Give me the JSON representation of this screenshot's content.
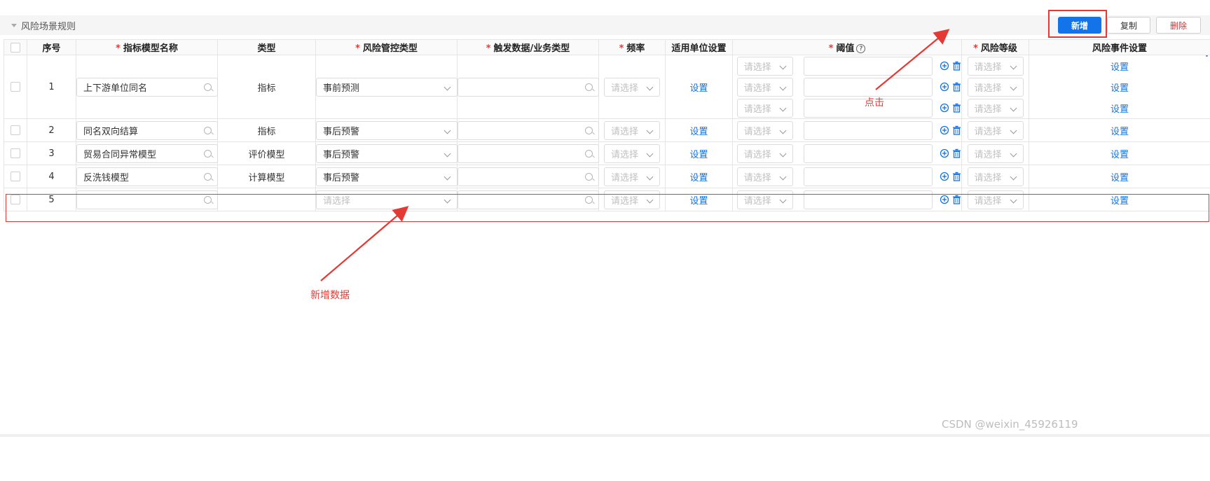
{
  "section": {
    "title": "风险场景规则"
  },
  "toolbar": {
    "add_label": "新增",
    "copy_label": "复制",
    "delete_label": "删除"
  },
  "columns": {
    "seq": "序号",
    "name": "指标模型名称",
    "type": "类型",
    "control": "风险管控类型",
    "trigger": "触发数据/业务类型",
    "freq": "频率",
    "unit": "适用单位设置",
    "threshold": "阈值",
    "level": "风险等级",
    "event": "风险事件设置",
    "required_mark": "*",
    "help_mark": "?"
  },
  "placeholder": "请选择",
  "set_label": "设置",
  "rows": [
    {
      "seq": "1",
      "name": "上下游单位同名",
      "type": "指标",
      "control": "事前预测"
    },
    {
      "seq": "2",
      "name": "同名双向结算",
      "type": "指标",
      "control": "事后预警"
    },
    {
      "seq": "3",
      "name": "贸易合同异常模型",
      "type": "评价模型",
      "control": "事后预警"
    },
    {
      "seq": "4",
      "name": "反洗钱模型",
      "type": "计算模型",
      "control": "事后预警"
    },
    {
      "seq": "5",
      "name": "",
      "type": "",
      "control": ""
    }
  ],
  "annotations": {
    "click": "点击",
    "new_data": "新增数据"
  },
  "watermark": "CSDN @weixin_45926119",
  "colors": {
    "primary": "#1274e8",
    "annotation_red": "#e53935",
    "delete_text": "#e0282e"
  },
  "icons": [
    "search-icon",
    "chevron-down-icon",
    "add-circle-icon",
    "trash-icon",
    "help-icon",
    "caret-down-icon"
  ]
}
